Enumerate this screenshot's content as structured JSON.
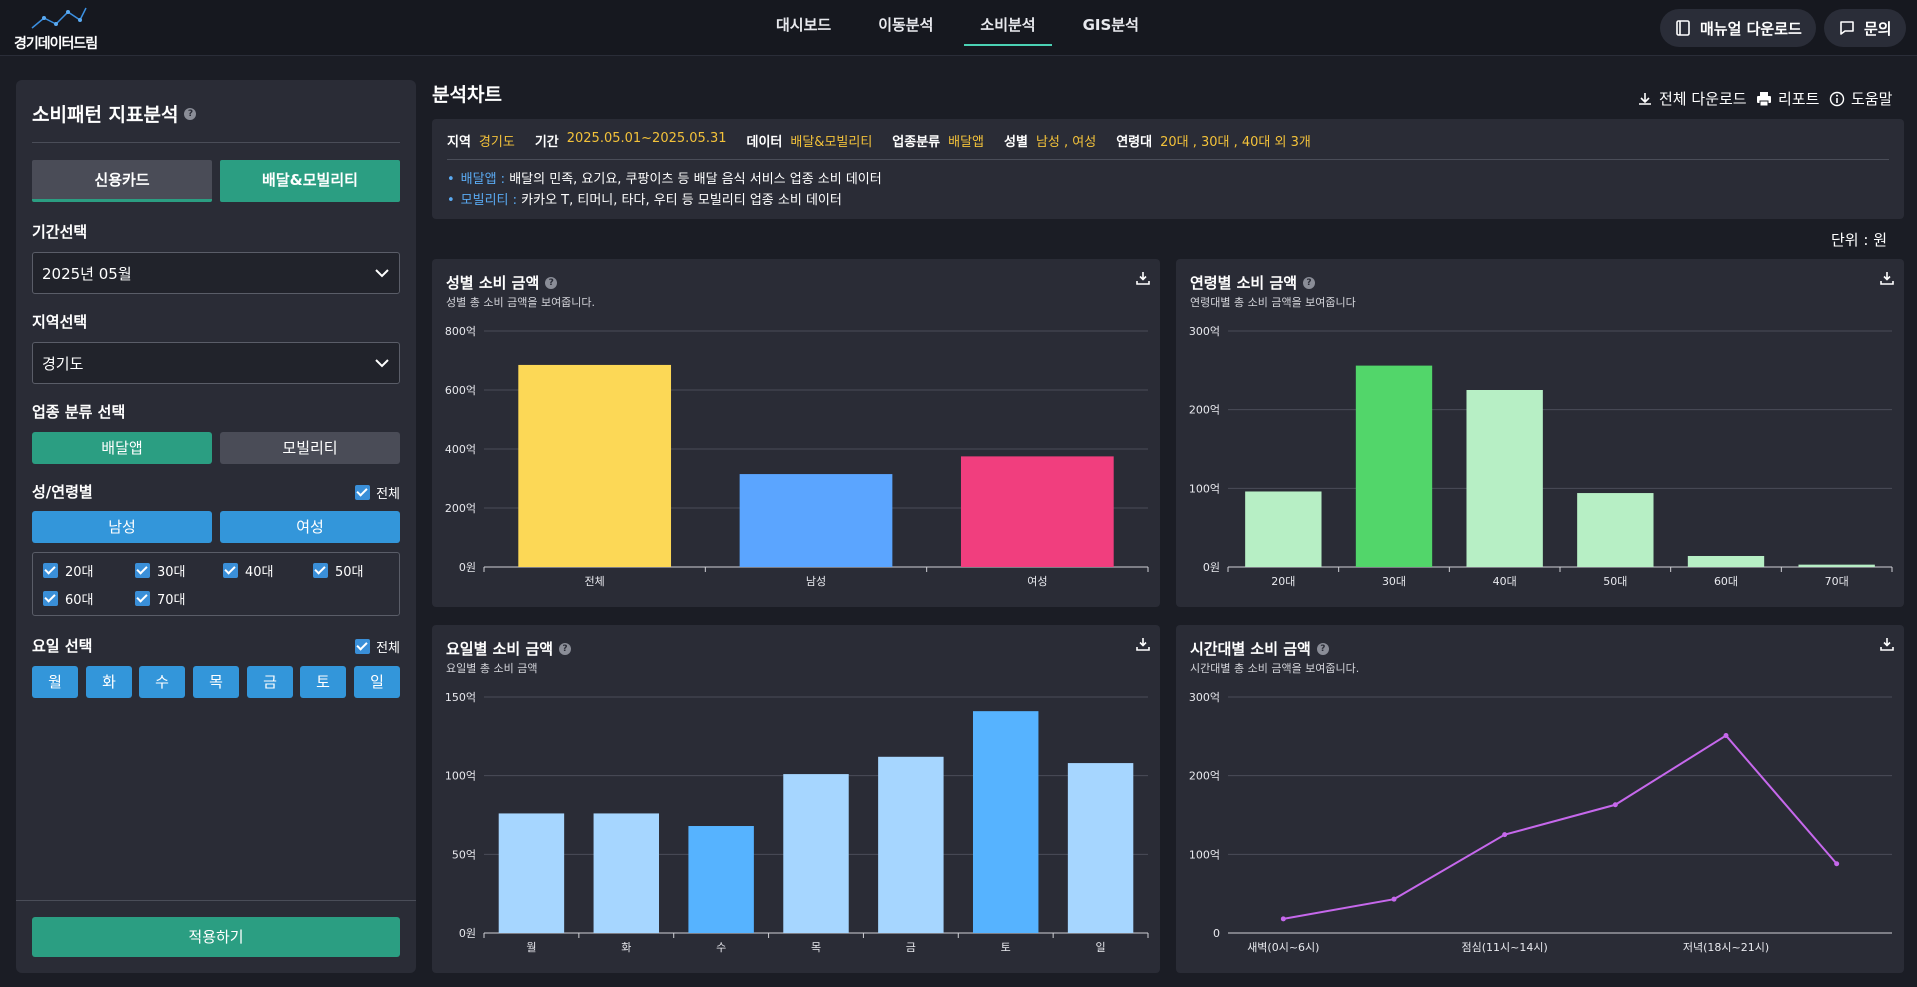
{
  "logo": {
    "text": "경기데이터드림"
  },
  "nav": [
    {
      "label": "대시보드",
      "active": false
    },
    {
      "label": "이동분석",
      "active": false
    },
    {
      "label": "소비분석",
      "active": true
    },
    {
      "label": "GIS분석",
      "active": false
    }
  ],
  "header": {
    "manual_label": "매뉴얼 다운로드",
    "inquiry_label": "문의"
  },
  "sidebar": {
    "title": "소비패턴 지표분석",
    "tabs": [
      {
        "label": "신용카드",
        "active": false
      },
      {
        "label": "배달&모빌리티",
        "active": true
      }
    ],
    "period_label": "기간선택",
    "period_value": "2025년 05월",
    "region_label": "지역선택",
    "region_value": "경기도",
    "industry_label": "업종 분류 선택",
    "industry_options": [
      {
        "label": "배달앱",
        "active": true
      },
      {
        "label": "모빌리티",
        "active": false
      }
    ],
    "gender_age_label": "성/연령별",
    "all_label": "전체",
    "gender_options": [
      "남성",
      "여성"
    ],
    "age_options": [
      "20대",
      "30대",
      "40대",
      "50대",
      "60대",
      "70대"
    ],
    "day_label": "요일 선택",
    "days": [
      "월",
      "화",
      "수",
      "목",
      "금",
      "토",
      "일"
    ],
    "apply_label": "적용하기"
  },
  "main": {
    "title": "분석차트",
    "tools": {
      "download_all": "전체 다운로드",
      "report": "리포트",
      "help": "도움말"
    },
    "filters": [
      {
        "key": "지역",
        "value": "경기도"
      },
      {
        "key": "기간",
        "value": "2025.05.01~2025.05.31"
      },
      {
        "key": "데이터",
        "value": "배달&모빌리티"
      },
      {
        "key": "업종분류",
        "value": "배달앱"
      },
      {
        "key": "성별",
        "value": "남성 , 여성"
      },
      {
        "key": "연령대",
        "value": "20대 , 30대 , 40대 외 3개"
      }
    ],
    "notes": [
      {
        "key": "배달앱 :",
        "text": "배달의 민족, 요기요, 쿠팡이츠 등 배달 음식 서비스 업종 소비 데이터"
      },
      {
        "key": "모빌리티 :",
        "text": "카카오 T, 티머니, 타다, 우티 등 모빌리티 업종 소비 데이터"
      }
    ],
    "unit": "단위 : 원"
  },
  "chart_data": [
    {
      "id": "gender",
      "type": "bar",
      "title": "성별 소비 금액",
      "subtitle": "성별 총 소비 금액을 보여줍니다.",
      "categories": [
        "전체",
        "남성",
        "여성"
      ],
      "values": [
        685,
        315,
        375
      ],
      "colors": [
        "#fcd856",
        "#5ba5ff",
        "#f13e7e"
      ],
      "yticks": [
        "0원",
        "200억",
        "400억",
        "600억",
        "800억"
      ],
      "ylim": [
        0,
        800
      ]
    },
    {
      "id": "age",
      "type": "bar",
      "title": "연령별 소비 금액",
      "subtitle": "연령대별 총 소비 금액을 보여줍니다",
      "categories": [
        "20대",
        "30대",
        "40대",
        "50대",
        "60대",
        "70대"
      ],
      "values": [
        96,
        256,
        225,
        94,
        14,
        3
      ],
      "colors": [
        "#b7efc5",
        "#52d66a",
        "#b7efc5",
        "#b7efc5",
        "#b7efc5",
        "#b7efc5"
      ],
      "yticks": [
        "0원",
        "100억",
        "200억",
        "300억"
      ],
      "ylim": [
        0,
        300
      ]
    },
    {
      "id": "weekday",
      "type": "bar",
      "title": "요일별 소비 금액",
      "subtitle": "요일별 총 소비 금액",
      "categories": [
        "월",
        "화",
        "수",
        "목",
        "금",
        "토",
        "일"
      ],
      "values": [
        76,
        76,
        68,
        101,
        112,
        141,
        108
      ],
      "colors": [
        "#a6d6ff",
        "#a6d6ff",
        "#56b3ff",
        "#a6d6ff",
        "#a6d6ff",
        "#56b3ff",
        "#a6d6ff"
      ],
      "yticks": [
        "0원",
        "50억",
        "100억",
        "150억"
      ],
      "ylim": [
        0,
        150
      ]
    },
    {
      "id": "hourly",
      "type": "line",
      "title": "시간대별 소비 금액",
      "subtitle": "시간대별 총 소비 금액을 보여줍니다.",
      "x": [
        "새벽(0시~6시)",
        "",
        "점심(11시~14시)",
        "",
        "저녁(18시~21시)",
        ""
      ],
      "values": [
        18,
        43,
        125,
        163,
        251,
        88
      ],
      "color": "#c668ec",
      "yticks": [
        "0",
        "100억",
        "200억",
        "300억"
      ],
      "ylim": [
        0,
        300
      ]
    }
  ]
}
